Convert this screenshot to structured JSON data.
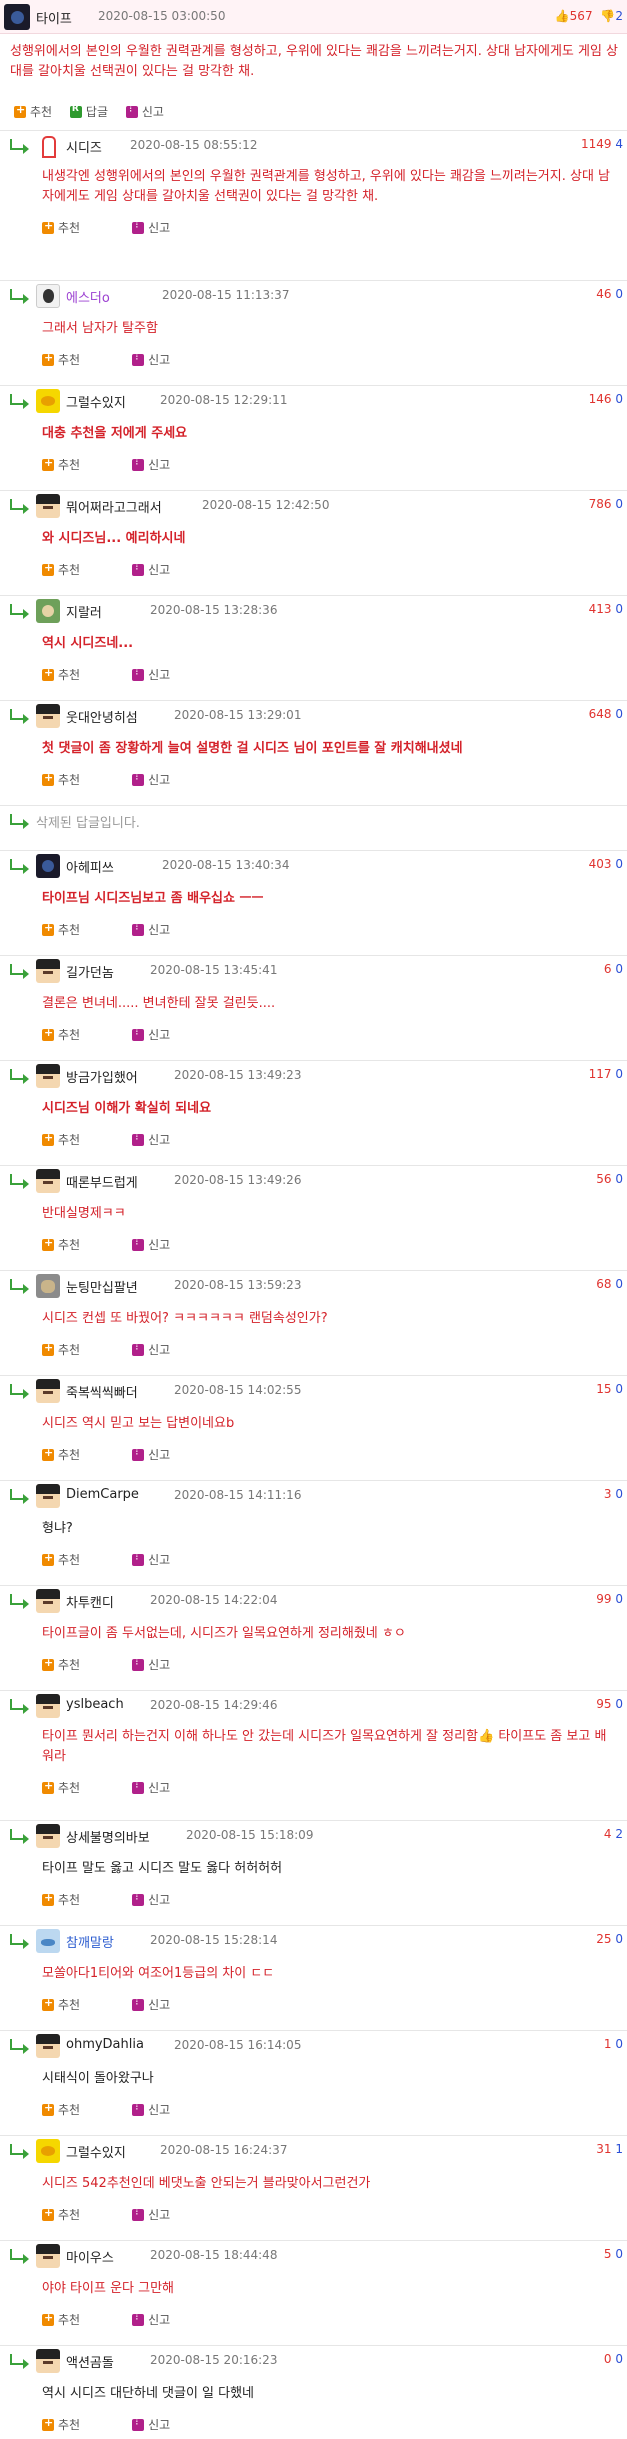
{
  "post": {
    "author": "타이프",
    "date": "2020-08-15 03:00:50",
    "up": "567",
    "down": "2",
    "text": "성행위에서의 본인의 우월한 권력관계를 형성하고, 우위에 있다는 쾌감을 느끼려는거지. 상대 남자에게도 게임 상대를 갈아치울 선택권이 있다는 걸 망각한 채.",
    "actions": {
      "recommend": "추천",
      "reply": "답글",
      "report": "신고"
    }
  },
  "comment_actions": {
    "recommend": "추천",
    "report": "신고"
  },
  "comments": [
    {
      "author": "시디즈",
      "date": "2020-08-15 08:55:12",
      "up": "1149",
      "down": "4",
      "text": "내생각엔 성행위에서의 본인의 우월한 권력관계를 형성하고, 우위에 있다는 쾌감을 느끼려는거지. 상대 남자에게도 게임 상대를 갈아치울 선택권이 있다는 걸 망각한 채."
    },
    {
      "author": "에스더o",
      "date": "2020-08-15 11:13:37",
      "up": "46",
      "down": "0",
      "text": "그래서 남자가 탈주함"
    },
    {
      "author": "그럴수있지",
      "date": "2020-08-15 12:29:11",
      "up": "146",
      "down": "0",
      "text": "대충 추천을 저에게 주세요"
    },
    {
      "author": "뭐어쩌라고그래서",
      "date": "2020-08-15 12:42:50",
      "up": "786",
      "down": "0",
      "text": "와 시디즈님... 예리하시네"
    },
    {
      "author": "지랄러",
      "date": "2020-08-15 13:28:36",
      "up": "413",
      "down": "0",
      "text": "역시 시디즈네..."
    },
    {
      "author": "웃대안녕히섬",
      "date": "2020-08-15 13:29:01",
      "up": "648",
      "down": "0",
      "text": "첫 댓글이 좀 장황하게 늘여 설명한 걸 시디즈 님이 포인트를 잘 캐치해내셨네"
    },
    {
      "deleted": "삭제된 답글입니다."
    },
    {
      "author": "아헤피쓰",
      "date": "2020-08-15 13:40:34",
      "up": "403",
      "down": "0",
      "text": "타이프님 시디즈님보고 좀 배우십쇼 ㅡㅡ"
    },
    {
      "author": "길가던놈",
      "date": "2020-08-15 13:45:41",
      "up": "6",
      "down": "0",
      "text": "결론은 변녀네..... 변녀한테 잘못 걸린듯...."
    },
    {
      "author": "방금가입했어",
      "date": "2020-08-15 13:49:23",
      "up": "117",
      "down": "0",
      "text": "시디즈님 이해가 확실히 되네요"
    },
    {
      "author": "때론부드럽게",
      "date": "2020-08-15 13:49:26",
      "up": "56",
      "down": "0",
      "text": "반대실명제ㅋㅋ"
    },
    {
      "author": "눈팅만십팔년",
      "date": "2020-08-15 13:59:23",
      "up": "68",
      "down": "0",
      "text": "시디즈 컨셉 또 바꿨어? ㅋㅋㅋㅋㅋㅋ 랜덤속성인가?"
    },
    {
      "author": "죽복씩씩빠더",
      "date": "2020-08-15 14:02:55",
      "up": "15",
      "down": "0",
      "text": "시디즈 역시 믿고 보는 답변이네요b"
    },
    {
      "author": "DiemCarpe",
      "date": "2020-08-15 14:11:16",
      "up": "3",
      "down": "0",
      "text": "형냐?"
    },
    {
      "author": "차투캔디",
      "date": "2020-08-15 14:22:04",
      "up": "99",
      "down": "0",
      "text": "타이프글이 좀 두서없는데, 시디즈가 일목요연하게 정리해줬네 ㅎㅇ"
    },
    {
      "author": "yslbeach",
      "date": "2020-08-15 14:29:46",
      "up": "95",
      "down": "0",
      "text": "타이프 뭔서리 하는건지 이해 하나도 안 갔는데 시디즈가 일목요연하게 잘 정리함👍 타이프도 좀 보고 배워라"
    },
    {
      "author": "상세불명의바보",
      "date": "2020-08-15 15:18:09",
      "up": "4",
      "down": "2",
      "text": "타이프 말도 옳고 시디즈 말도 옳다 허허허허"
    },
    {
      "author": "참깨말랑",
      "date": "2020-08-15 15:28:14",
      "up": "25",
      "down": "0",
      "text": "모쏠아다1티어와 여조어1등급의 차이 ㄷㄷ"
    },
    {
      "author": "ohmyDahlia",
      "date": "2020-08-15 16:14:05",
      "up": "1",
      "down": "0",
      "text": "시태식이 돌아왔구나"
    },
    {
      "author": "그럴수있지",
      "date": "2020-08-15 16:24:37",
      "up": "31",
      "down": "1",
      "text": "시디즈 542추천인데 베댓노출 안되는거 블라맞아서그런건가"
    },
    {
      "author": "마이우스",
      "date": "2020-08-15 18:44:48",
      "up": "5",
      "down": "0",
      "text": "야야 타이프 운다 그만해"
    },
    {
      "author": "액션곰돌",
      "date": "2020-08-15 20:16:23",
      "up": "0",
      "down": "0",
      "text": "역시 시디즈 대단하네 댓글이 일 다했네"
    }
  ]
}
